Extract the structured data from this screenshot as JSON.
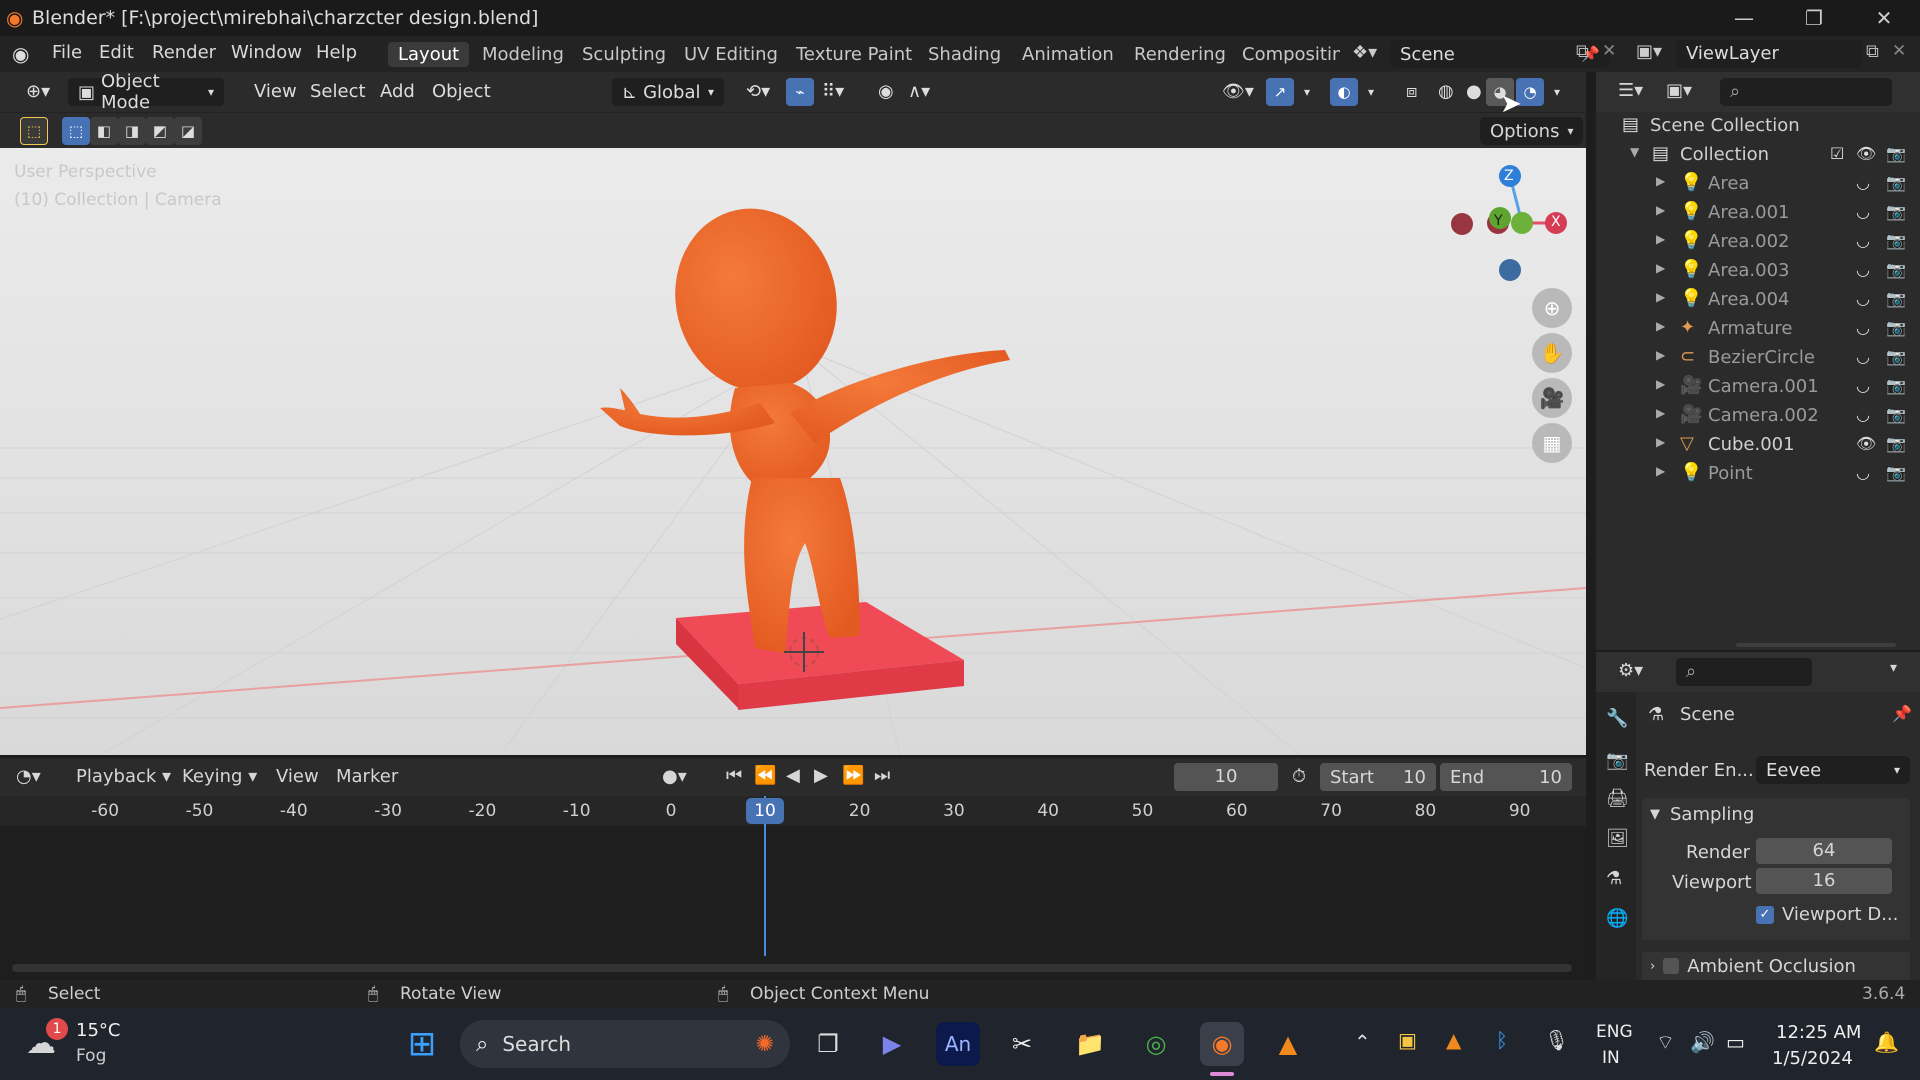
{
  "window": {
    "title": "Blender* [F:\\project\\mirebhai\\charzcter design.blend]",
    "minimize": "—",
    "maximize": "❐",
    "close": "✕"
  },
  "menubar": {
    "menus": [
      "File",
      "Edit",
      "Render",
      "Window",
      "Help"
    ],
    "workspaces": [
      "Layout",
      "Modeling",
      "Sculpting",
      "UV Editing",
      "Texture Paint",
      "Shading",
      "Animation",
      "Rendering",
      "Compositin"
    ],
    "active_workspace": "Layout",
    "scene": "Scene",
    "view_layer": "ViewLayer"
  },
  "viewport_header": {
    "mode": "Object Mode",
    "menus": [
      "View",
      "Select",
      "Add",
      "Object"
    ],
    "transform_orientation": "Global",
    "options_label": "Options"
  },
  "viewport": {
    "perspective": "User Perspective",
    "collection_info": "(10) Collection | Camera",
    "gizmo": {
      "z": "Z",
      "y": "Y",
      "x": "X"
    },
    "accent_orange": "#f26a2e",
    "base_red": "#ea3e4a"
  },
  "outliner": {
    "scene_collection": "Scene Collection",
    "collection": "Collection",
    "items": [
      {
        "label": "Area",
        "icon": "light-icon",
        "visible": false
      },
      {
        "label": "Area.001",
        "icon": "light-icon",
        "visible": false
      },
      {
        "label": "Area.002",
        "icon": "light-icon",
        "visible": false
      },
      {
        "label": "Area.003",
        "icon": "light-icon",
        "visible": false
      },
      {
        "label": "Area.004",
        "icon": "light-icon",
        "visible": false
      },
      {
        "label": "Armature",
        "icon": "armature-icon",
        "visible": false
      },
      {
        "label": "BezierCircle",
        "icon": "curve-icon",
        "visible": false
      },
      {
        "label": "Camera.001",
        "icon": "camera-icon",
        "visible": false
      },
      {
        "label": "Camera.002",
        "icon": "camera-icon",
        "visible": false
      },
      {
        "label": "Cube.001",
        "icon": "mesh-icon",
        "visible": true
      },
      {
        "label": "Point",
        "icon": "light-icon",
        "visible": false
      }
    ]
  },
  "properties": {
    "scene_label": "Scene",
    "render_engine_label": "Render En...",
    "render_engine_value": "Eevee",
    "sampling_label": "Sampling",
    "render_label": "Render",
    "render_value": "64",
    "viewport_label": "Viewport",
    "viewport_value": "16",
    "viewport_denoise_label": "Viewport D...",
    "ambient_occlusion_label": "Ambient Occlusion"
  },
  "timeline": {
    "menus": [
      "Playback",
      "Keying",
      "View",
      "Marker"
    ],
    "current_frame": "10",
    "start_label": "Start",
    "start_value": "10",
    "end_label": "End",
    "end_value": "10",
    "ticks": [
      "-60",
      "-50",
      "-40",
      "-30",
      "-20",
      "-10",
      "0",
      "10",
      "20",
      "30",
      "40",
      "50",
      "60",
      "70",
      "80",
      "90"
    ]
  },
  "statusbar": {
    "select": "Select",
    "rotate": "Rotate View",
    "context": "Object Context Menu",
    "version": "3.6.4"
  },
  "taskbar": {
    "weather_temp": "15°C",
    "weather_desc": "Fog",
    "weather_badge": "1",
    "search": "Search",
    "lang1": "ENG",
    "lang2": "IN",
    "time": "12:25 AM",
    "date": "1/5/2024"
  }
}
